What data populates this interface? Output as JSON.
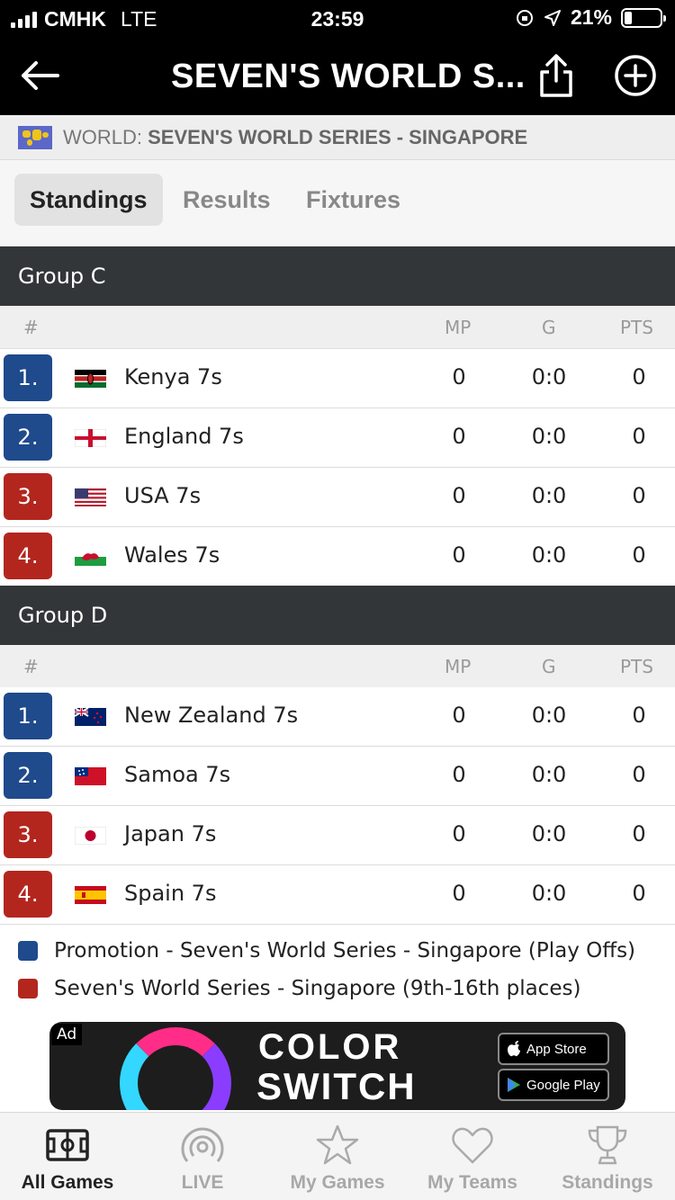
{
  "status_bar": {
    "carrier": "CMHK",
    "network": "LTE",
    "time": "23:59",
    "battery": "21%"
  },
  "nav": {
    "title": "SEVEN'S WORLD S...",
    "back_icon": "arrow-left-icon",
    "share_icon": "share-icon",
    "add_icon": "plus-circle-icon"
  },
  "breadcrumb": {
    "region": "WORLD:",
    "competition": "SEVEN'S WORLD SERIES - SINGAPORE"
  },
  "tabs": [
    {
      "label": "Standings",
      "active": true
    },
    {
      "label": "Results",
      "active": false
    },
    {
      "label": "Fixtures",
      "active": false
    }
  ],
  "columns": {
    "rank": "#",
    "mp": "MP",
    "g": "G",
    "pts": "PTS"
  },
  "groups": [
    {
      "name": "Group C",
      "rows": [
        {
          "rank": "1.",
          "team": "Kenya 7s",
          "mp": "0",
          "g": "0:0",
          "pts": "0",
          "zone": "promotion"
        },
        {
          "rank": "2.",
          "team": "England 7s",
          "mp": "0",
          "g": "0:0",
          "pts": "0",
          "zone": "promotion"
        },
        {
          "rank": "3.",
          "team": "USA 7s",
          "mp": "0",
          "g": "0:0",
          "pts": "0",
          "zone": "lower"
        },
        {
          "rank": "4.",
          "team": "Wales 7s",
          "mp": "0",
          "g": "0:0",
          "pts": "0",
          "zone": "lower"
        }
      ]
    },
    {
      "name": "Group D",
      "rows": [
        {
          "rank": "1.",
          "team": "New Zealand 7s",
          "mp": "0",
          "g": "0:0",
          "pts": "0",
          "zone": "promotion"
        },
        {
          "rank": "2.",
          "team": "Samoa 7s",
          "mp": "0",
          "g": "0:0",
          "pts": "0",
          "zone": "promotion"
        },
        {
          "rank": "3.",
          "team": "Japan 7s",
          "mp": "0",
          "g": "0:0",
          "pts": "0",
          "zone": "lower"
        },
        {
          "rank": "4.",
          "team": "Spain 7s",
          "mp": "0",
          "g": "0:0",
          "pts": "0",
          "zone": "lower"
        }
      ]
    }
  ],
  "legend": [
    {
      "label": "Promotion - Seven's World Series - Singapore (Play Offs)",
      "color": "#1f4a8c"
    },
    {
      "label": "Seven's World Series - Singapore (9th-16th places)",
      "color": "#b3261e"
    }
  ],
  "ad": {
    "tag": "Ad",
    "brand_line1": "COLOR",
    "brand_line2": "SWITCH",
    "app_store": "App Store",
    "google_play": "Google Play"
  },
  "tabbar": [
    {
      "label": "All Games",
      "icon": "field-icon",
      "active": true
    },
    {
      "label": "LIVE",
      "icon": "live-icon",
      "active": false
    },
    {
      "label": "My Games",
      "icon": "star-icon",
      "active": false
    },
    {
      "label": "My Teams",
      "icon": "heart-icon",
      "active": false
    },
    {
      "label": "Standings",
      "icon": "trophy-icon",
      "active": false
    }
  ],
  "colors": {
    "promotion": "#1f4a8c",
    "lower": "#b3261e",
    "header_bg": "#333638"
  }
}
